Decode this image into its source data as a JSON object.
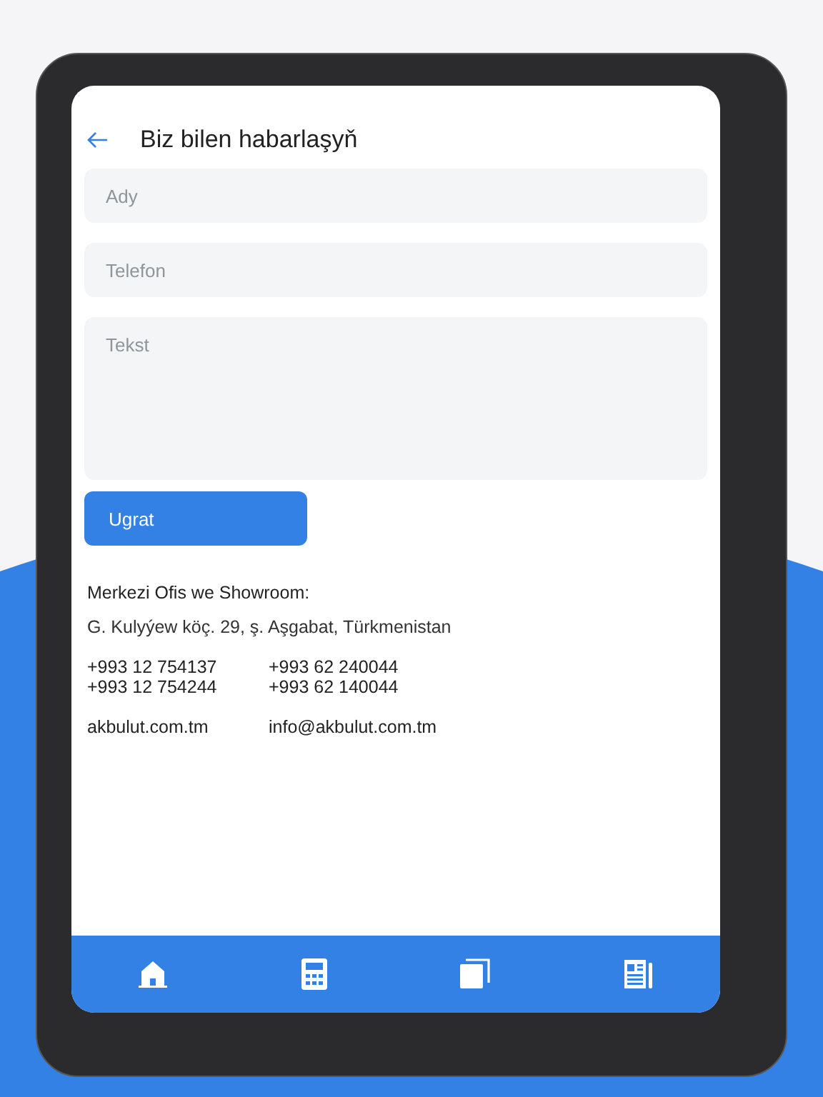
{
  "header": {
    "title": "Biz bilen habarlaşyň"
  },
  "form": {
    "fields": [
      {
        "placeholder": "Ady",
        "kind": "line"
      },
      {
        "placeholder": "Telefon",
        "kind": "line"
      },
      {
        "placeholder": "Tekst",
        "kind": "area"
      }
    ],
    "submit": "Ugrat"
  },
  "contact": {
    "heading": "Merkezi Ofis we Showroom:",
    "address": "G. Kulyýew köç. 29, ş. Aşgabat, Türkmenistan",
    "phones_left": [
      "+993 12 754137",
      "+993 12 754244"
    ],
    "phones_right": [
      "+993 62 240044",
      "+993 62 140044"
    ],
    "website": "akbulut.com.tm",
    "email": "info@akbulut.com.tm"
  },
  "bottom_nav": [
    {
      "kind": "home"
    },
    {
      "kind": "calculator"
    },
    {
      "kind": "copies"
    },
    {
      "kind": "news"
    }
  ]
}
